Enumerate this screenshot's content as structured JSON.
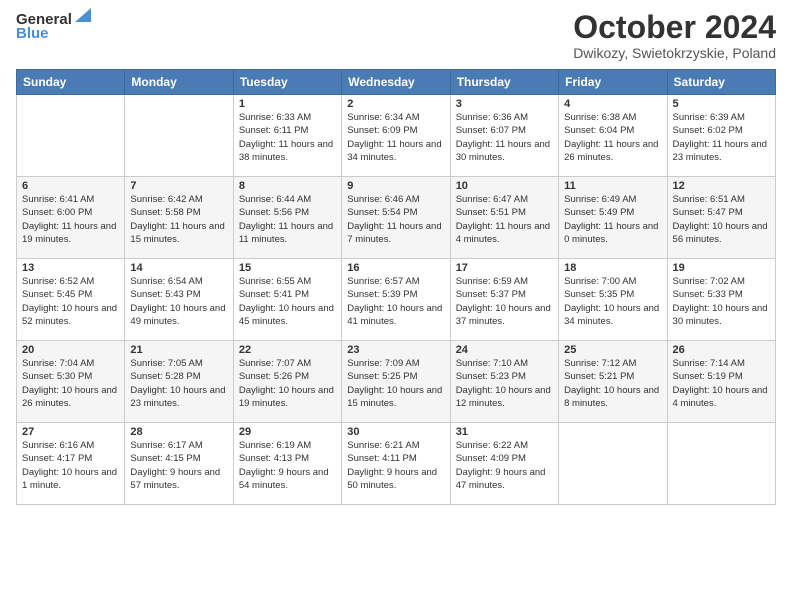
{
  "header": {
    "logo_general": "General",
    "logo_blue": "Blue",
    "title": "October 2024",
    "subtitle": "Dwikozy, Swietokrzyskie, Poland"
  },
  "days_of_week": [
    "Sunday",
    "Monday",
    "Tuesday",
    "Wednesday",
    "Thursday",
    "Friday",
    "Saturday"
  ],
  "weeks": [
    [
      {
        "day": "",
        "info": ""
      },
      {
        "day": "",
        "info": ""
      },
      {
        "day": "1",
        "info": "Sunrise: 6:33 AM\nSunset: 6:11 PM\nDaylight: 11 hours and 38 minutes."
      },
      {
        "day": "2",
        "info": "Sunrise: 6:34 AM\nSunset: 6:09 PM\nDaylight: 11 hours and 34 minutes."
      },
      {
        "day": "3",
        "info": "Sunrise: 6:36 AM\nSunset: 6:07 PM\nDaylight: 11 hours and 30 minutes."
      },
      {
        "day": "4",
        "info": "Sunrise: 6:38 AM\nSunset: 6:04 PM\nDaylight: 11 hours and 26 minutes."
      },
      {
        "day": "5",
        "info": "Sunrise: 6:39 AM\nSunset: 6:02 PM\nDaylight: 11 hours and 23 minutes."
      }
    ],
    [
      {
        "day": "6",
        "info": "Sunrise: 6:41 AM\nSunset: 6:00 PM\nDaylight: 11 hours and 19 minutes."
      },
      {
        "day": "7",
        "info": "Sunrise: 6:42 AM\nSunset: 5:58 PM\nDaylight: 11 hours and 15 minutes."
      },
      {
        "day": "8",
        "info": "Sunrise: 6:44 AM\nSunset: 5:56 PM\nDaylight: 11 hours and 11 minutes."
      },
      {
        "day": "9",
        "info": "Sunrise: 6:46 AM\nSunset: 5:54 PM\nDaylight: 11 hours and 7 minutes."
      },
      {
        "day": "10",
        "info": "Sunrise: 6:47 AM\nSunset: 5:51 PM\nDaylight: 11 hours and 4 minutes."
      },
      {
        "day": "11",
        "info": "Sunrise: 6:49 AM\nSunset: 5:49 PM\nDaylight: 11 hours and 0 minutes."
      },
      {
        "day": "12",
        "info": "Sunrise: 6:51 AM\nSunset: 5:47 PM\nDaylight: 10 hours and 56 minutes."
      }
    ],
    [
      {
        "day": "13",
        "info": "Sunrise: 6:52 AM\nSunset: 5:45 PM\nDaylight: 10 hours and 52 minutes."
      },
      {
        "day": "14",
        "info": "Sunrise: 6:54 AM\nSunset: 5:43 PM\nDaylight: 10 hours and 49 minutes."
      },
      {
        "day": "15",
        "info": "Sunrise: 6:55 AM\nSunset: 5:41 PM\nDaylight: 10 hours and 45 minutes."
      },
      {
        "day": "16",
        "info": "Sunrise: 6:57 AM\nSunset: 5:39 PM\nDaylight: 10 hours and 41 minutes."
      },
      {
        "day": "17",
        "info": "Sunrise: 6:59 AM\nSunset: 5:37 PM\nDaylight: 10 hours and 37 minutes."
      },
      {
        "day": "18",
        "info": "Sunrise: 7:00 AM\nSunset: 5:35 PM\nDaylight: 10 hours and 34 minutes."
      },
      {
        "day": "19",
        "info": "Sunrise: 7:02 AM\nSunset: 5:33 PM\nDaylight: 10 hours and 30 minutes."
      }
    ],
    [
      {
        "day": "20",
        "info": "Sunrise: 7:04 AM\nSunset: 5:30 PM\nDaylight: 10 hours and 26 minutes."
      },
      {
        "day": "21",
        "info": "Sunrise: 7:05 AM\nSunset: 5:28 PM\nDaylight: 10 hours and 23 minutes."
      },
      {
        "day": "22",
        "info": "Sunrise: 7:07 AM\nSunset: 5:26 PM\nDaylight: 10 hours and 19 minutes."
      },
      {
        "day": "23",
        "info": "Sunrise: 7:09 AM\nSunset: 5:25 PM\nDaylight: 10 hours and 15 minutes."
      },
      {
        "day": "24",
        "info": "Sunrise: 7:10 AM\nSunset: 5:23 PM\nDaylight: 10 hours and 12 minutes."
      },
      {
        "day": "25",
        "info": "Sunrise: 7:12 AM\nSunset: 5:21 PM\nDaylight: 10 hours and 8 minutes."
      },
      {
        "day": "26",
        "info": "Sunrise: 7:14 AM\nSunset: 5:19 PM\nDaylight: 10 hours and 4 minutes."
      }
    ],
    [
      {
        "day": "27",
        "info": "Sunrise: 6:16 AM\nSunset: 4:17 PM\nDaylight: 10 hours and 1 minute."
      },
      {
        "day": "28",
        "info": "Sunrise: 6:17 AM\nSunset: 4:15 PM\nDaylight: 9 hours and 57 minutes."
      },
      {
        "day": "29",
        "info": "Sunrise: 6:19 AM\nSunset: 4:13 PM\nDaylight: 9 hours and 54 minutes."
      },
      {
        "day": "30",
        "info": "Sunrise: 6:21 AM\nSunset: 4:11 PM\nDaylight: 9 hours and 50 minutes."
      },
      {
        "day": "31",
        "info": "Sunrise: 6:22 AM\nSunset: 4:09 PM\nDaylight: 9 hours and 47 minutes."
      },
      {
        "day": "",
        "info": ""
      },
      {
        "day": "",
        "info": ""
      }
    ]
  ]
}
